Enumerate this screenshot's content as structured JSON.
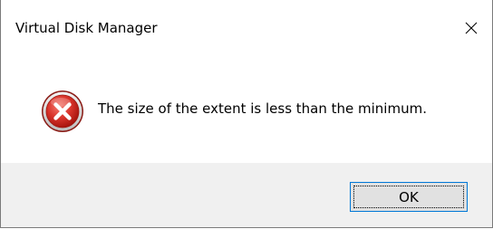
{
  "dialog": {
    "title": "Virtual Disk Manager",
    "message": "The size of the extent is less than the minimum.",
    "icon": "error-icon",
    "ok_label": "OK",
    "close_icon": "close-icon"
  },
  "colors": {
    "error_red": "#d32f2f",
    "footer_bg": "#f0f0f0",
    "button_bg": "#e1e1e1",
    "button_border": "#0078d7"
  }
}
